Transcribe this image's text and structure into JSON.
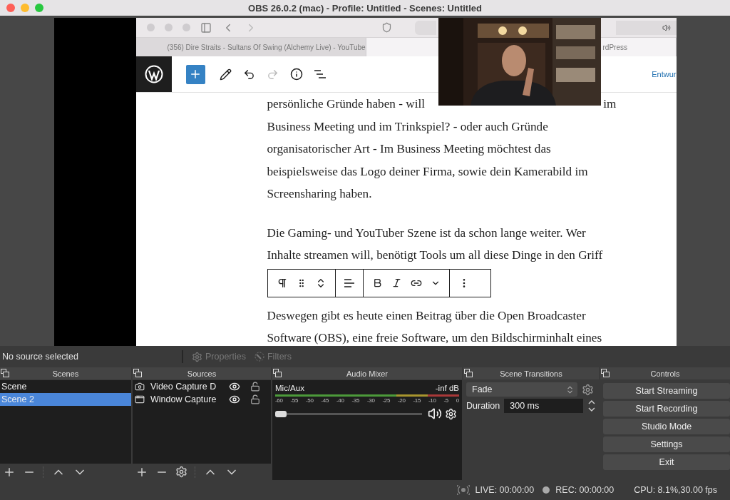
{
  "window": {
    "title": "OBS 26.0.2 (mac) - Profile: Untitled - Scenes: Untitled"
  },
  "preview": {
    "browser": {
      "tabs": [
        {
          "label": "(356) Dire Straits - Sultans Of Swing (Alchemy Live) - YouTube",
          "selected": false
        },
        {
          "label": "rdPress",
          "selected": true
        }
      ],
      "editor_status": "Entwur",
      "paragraphs": [
        {
          "lines": [
            "persönliche Gründe haben - will",
            "Business Meeting und im Trinkspiel? - oder auch Gründe",
            "organisatorischer Art  - Im Business Meeting möchtest das",
            "beispielsweise das Logo deiner Firma, sowie dein Kamerabild im",
            "Screensharing haben."
          ],
          "line_end": "im"
        },
        {
          "lines": [
            "Die Gaming- und YouTuber Szene ist da schon lange weiter. Wer",
            "Inhalte streamen will, benötigt Tools um all diese Dinge in den Griff"
          ]
        },
        {
          "lines": [
            "Deswegen gibt es heute einen Beitrag über die Open Broadcaster",
            "Software (OBS), eine freie Software, um den Bildschirminhalt eines"
          ]
        }
      ]
    }
  },
  "source_bar": {
    "status": "No source selected",
    "buttons": [
      {
        "label": "Properties",
        "kind": "properties",
        "disabled": true
      },
      {
        "label": "Filters",
        "kind": "filters",
        "disabled": true
      }
    ]
  },
  "scenes": {
    "title": "Scenes",
    "items": [
      {
        "name": "Scene",
        "selected": false
      },
      {
        "name": "Scene 2",
        "selected": true
      }
    ]
  },
  "sources": {
    "title": "Sources",
    "items": [
      {
        "name": "Video Capture D",
        "kind": "camera",
        "visible": true,
        "locked": false
      },
      {
        "name": "Window Capture",
        "kind": "window",
        "visible": true,
        "locked": false
      }
    ]
  },
  "audio_mixer": {
    "title": "Audio Mixer",
    "channels": [
      {
        "name": "Mic/Aux",
        "reading": "-inf dB",
        "level": 0,
        "muted": false
      }
    ],
    "scale": [
      "-60",
      "-55",
      "-50",
      "-45",
      "-40",
      "-35",
      "-30",
      "-25",
      "-20",
      "-15",
      "-10",
      "-5",
      "0"
    ]
  },
  "scene_transitions": {
    "title": "Scene Transitions",
    "transition": "Fade",
    "duration_label": "Duration",
    "duration": "300 ms"
  },
  "controls": {
    "title": "Controls",
    "buttons": [
      "Start Streaming",
      "Start Recording",
      "Studio Mode",
      "Settings",
      "Exit"
    ]
  },
  "status_bar": {
    "live": "LIVE: 00:00:00",
    "rec": "REC: 00:00:00",
    "cpu": "CPU: 8.1%,30.00 fps"
  }
}
